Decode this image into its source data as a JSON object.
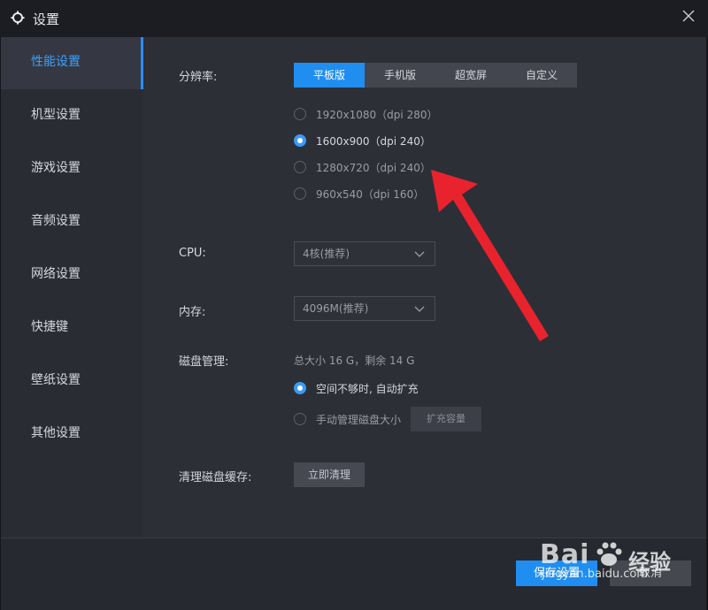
{
  "window": {
    "title": "设置"
  },
  "sidebar": {
    "items": [
      {
        "label": "性能设置",
        "active": true
      },
      {
        "label": "机型设置"
      },
      {
        "label": "游戏设置"
      },
      {
        "label": "音频设置"
      },
      {
        "label": "网络设置"
      },
      {
        "label": "快捷键"
      },
      {
        "label": "壁纸设置"
      },
      {
        "label": "其他设置"
      }
    ]
  },
  "resolution": {
    "label": "分辨率:",
    "tabs": [
      "平板版",
      "手机版",
      "超宽屏",
      "自定义"
    ],
    "active_tab": "平板版",
    "options": [
      "1920x1080（dpi 280）",
      "1600x900（dpi 240）",
      "1280x720（dpi 240）",
      "960x540（dpi 160）"
    ],
    "selected_option": "1600x900（dpi 240）"
  },
  "cpu": {
    "label": "CPU:",
    "value": "4核(推荐)"
  },
  "memory": {
    "label": "内存:",
    "value": "4096M(推荐)"
  },
  "disk": {
    "label": "磁盘管理:",
    "summary": "总大小 16 G，剩余 14 G",
    "auto_option": "空间不够时, 自动扩充",
    "manual_option": "手动管理磁盘大小",
    "expand_button": "扩充容量",
    "selected": "auto"
  },
  "cache": {
    "label": "清理磁盘缓存:",
    "button": "立即清理"
  },
  "footer": {
    "save": "保存设置",
    "cancel": "取消"
  },
  "watermark": {
    "logo": "Bai",
    "brand": "经验",
    "url": "jingyan.baidu.com"
  },
  "colors": {
    "accent": "#1f8ef0",
    "annotation_arrow": "#e8232d"
  }
}
